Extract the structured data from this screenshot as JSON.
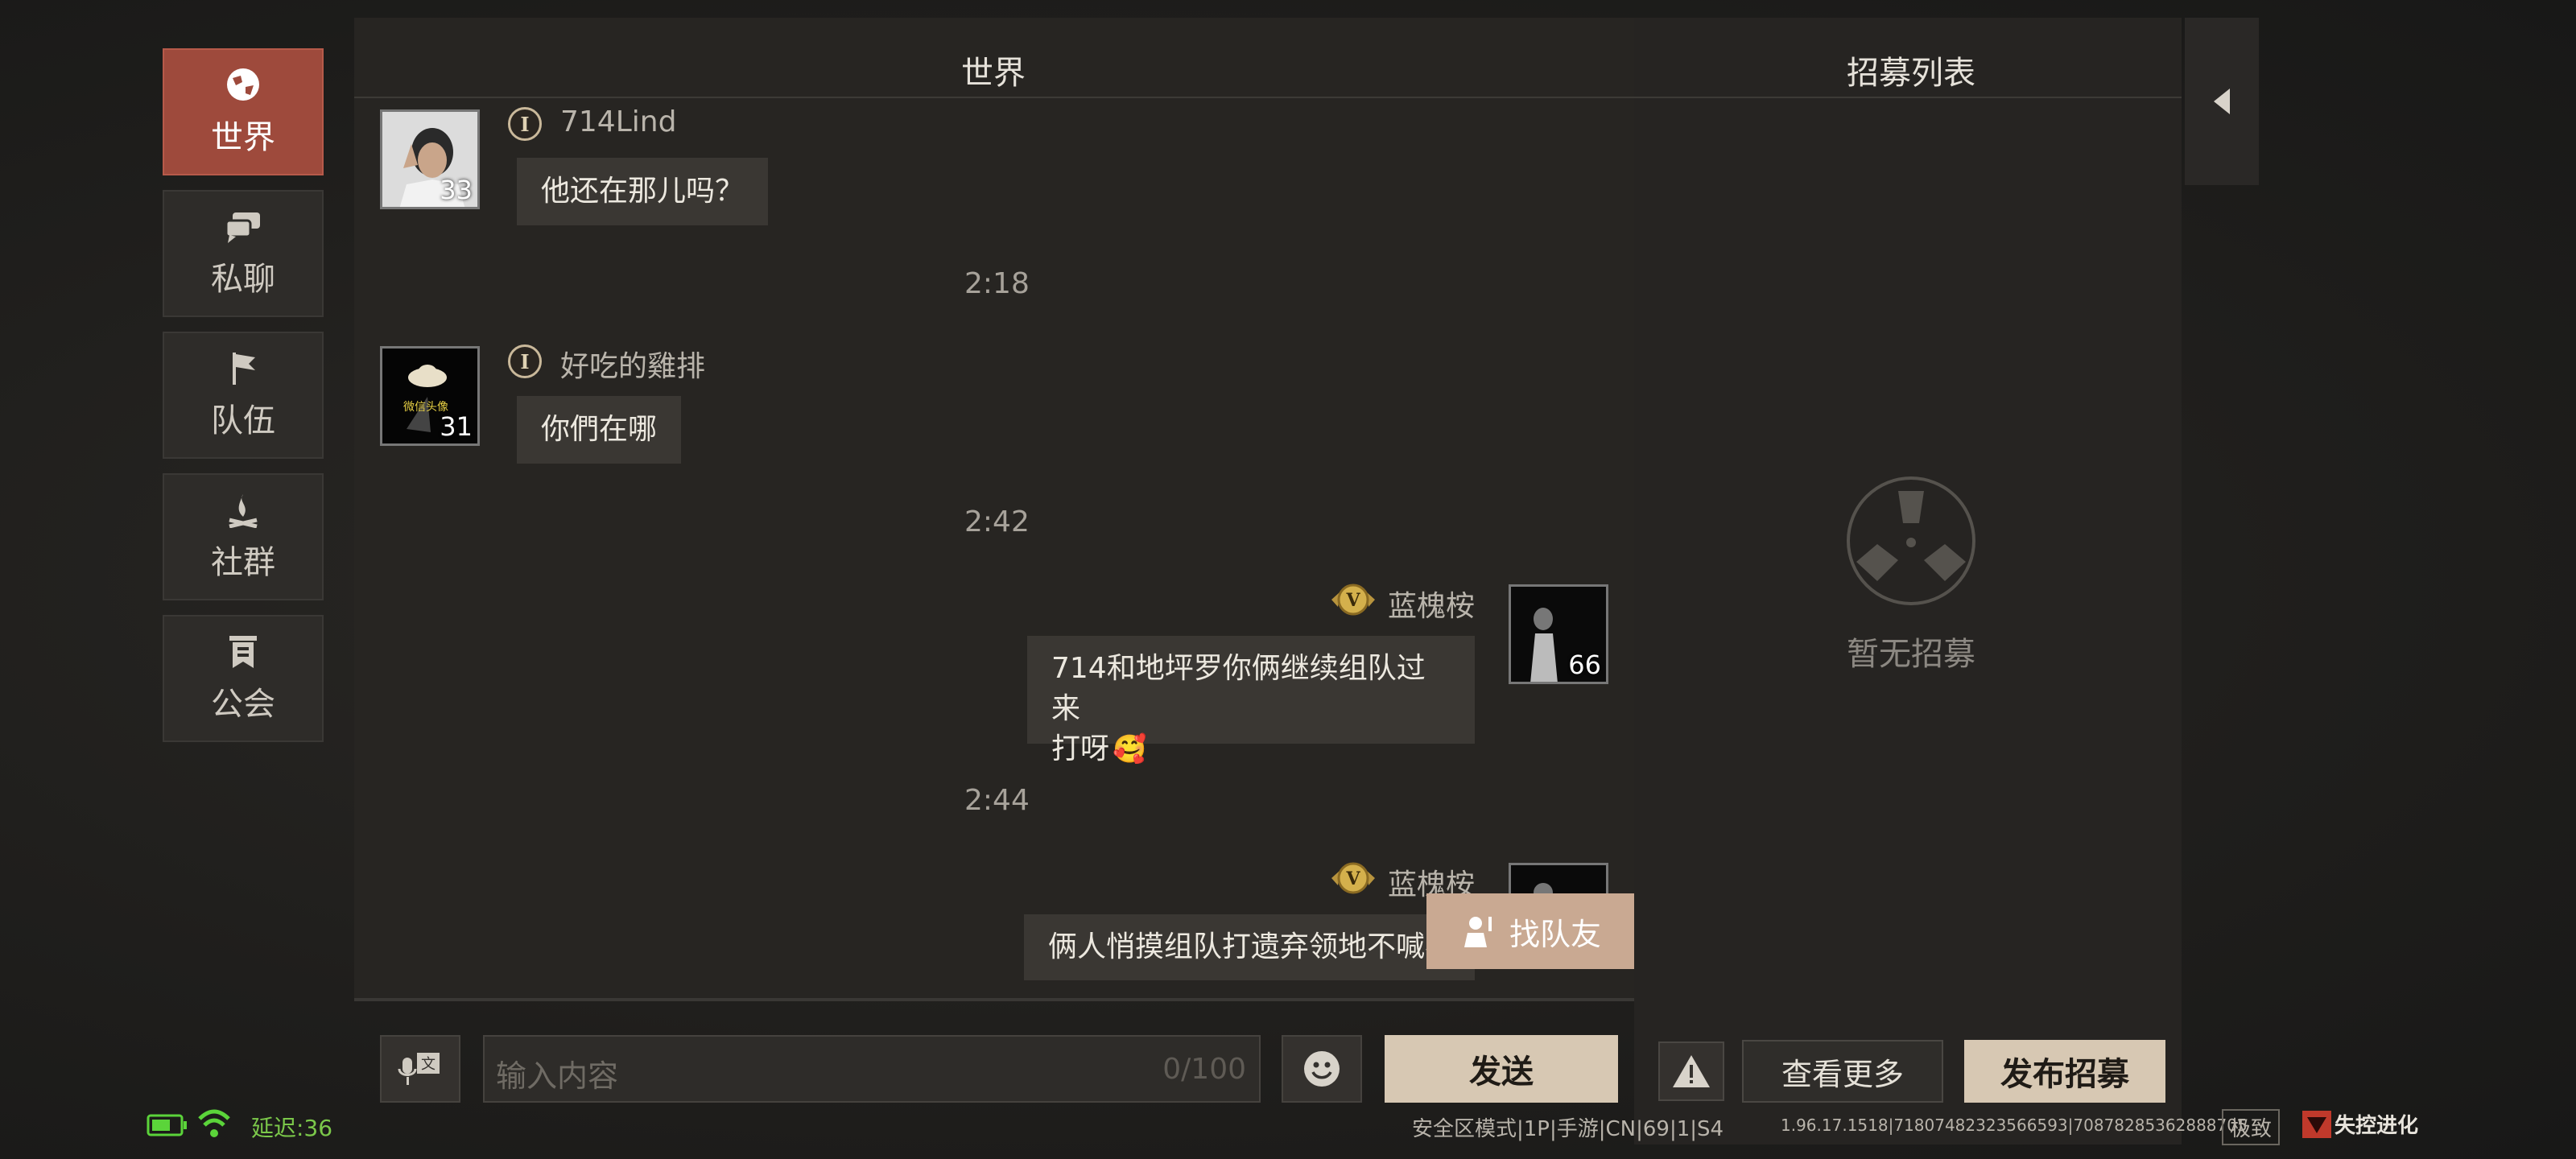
{
  "nav": {
    "items": [
      {
        "label": "世界",
        "icon": "globe-icon",
        "active": true
      },
      {
        "label": "私聊",
        "icon": "chat-bubbles-icon",
        "active": false
      },
      {
        "label": "队伍",
        "icon": "flag-icon",
        "active": false
      },
      {
        "label": "社群",
        "icon": "campfire-icon",
        "active": false
      },
      {
        "label": "公会",
        "icon": "banner-icon",
        "active": false
      }
    ]
  },
  "chat": {
    "title": "世界",
    "messages": [
      {
        "name": "714Lind",
        "level": "33",
        "text": "他还在那儿吗？"
      },
      {
        "time": "2:18"
      },
      {
        "name": "好吃的雞排",
        "level": "31",
        "avatar_caption": "微信头像",
        "text": "你們在哪"
      },
      {
        "time": "2:42"
      },
      {
        "name": "蓝槐桉",
        "level": "66",
        "text_line1": "714和地坪罗你俩继续组队过来",
        "text_line2": "打呀",
        "emoji": "🥰"
      },
      {
        "time": "2:44"
      },
      {
        "name": "蓝槐桉",
        "text": "俩人悄摸组队打遗弃领地不喊我"
      }
    ],
    "find_team_label": "找队友"
  },
  "input": {
    "placeholder": "输入内容",
    "counter": "0/100",
    "send_label": "发送"
  },
  "recruit": {
    "title": "招募列表",
    "empty_text": "暂无招募",
    "view_more_label": "查看更多",
    "publish_label": "发布招募"
  },
  "status": {
    "latency": "延迟:36",
    "mode": "安全区模式|1P|手游|CN|69|1|S4",
    "build": "1.96.17.1518|71807482323566593|70878285362888705",
    "quality": "极致",
    "logo_text": "失控进化"
  },
  "colors": {
    "accent_active": "#9e4a3c",
    "button_beige": "#d7c8b3",
    "battery_green": "#5bd43a",
    "latency_green": "#7bc84a"
  }
}
